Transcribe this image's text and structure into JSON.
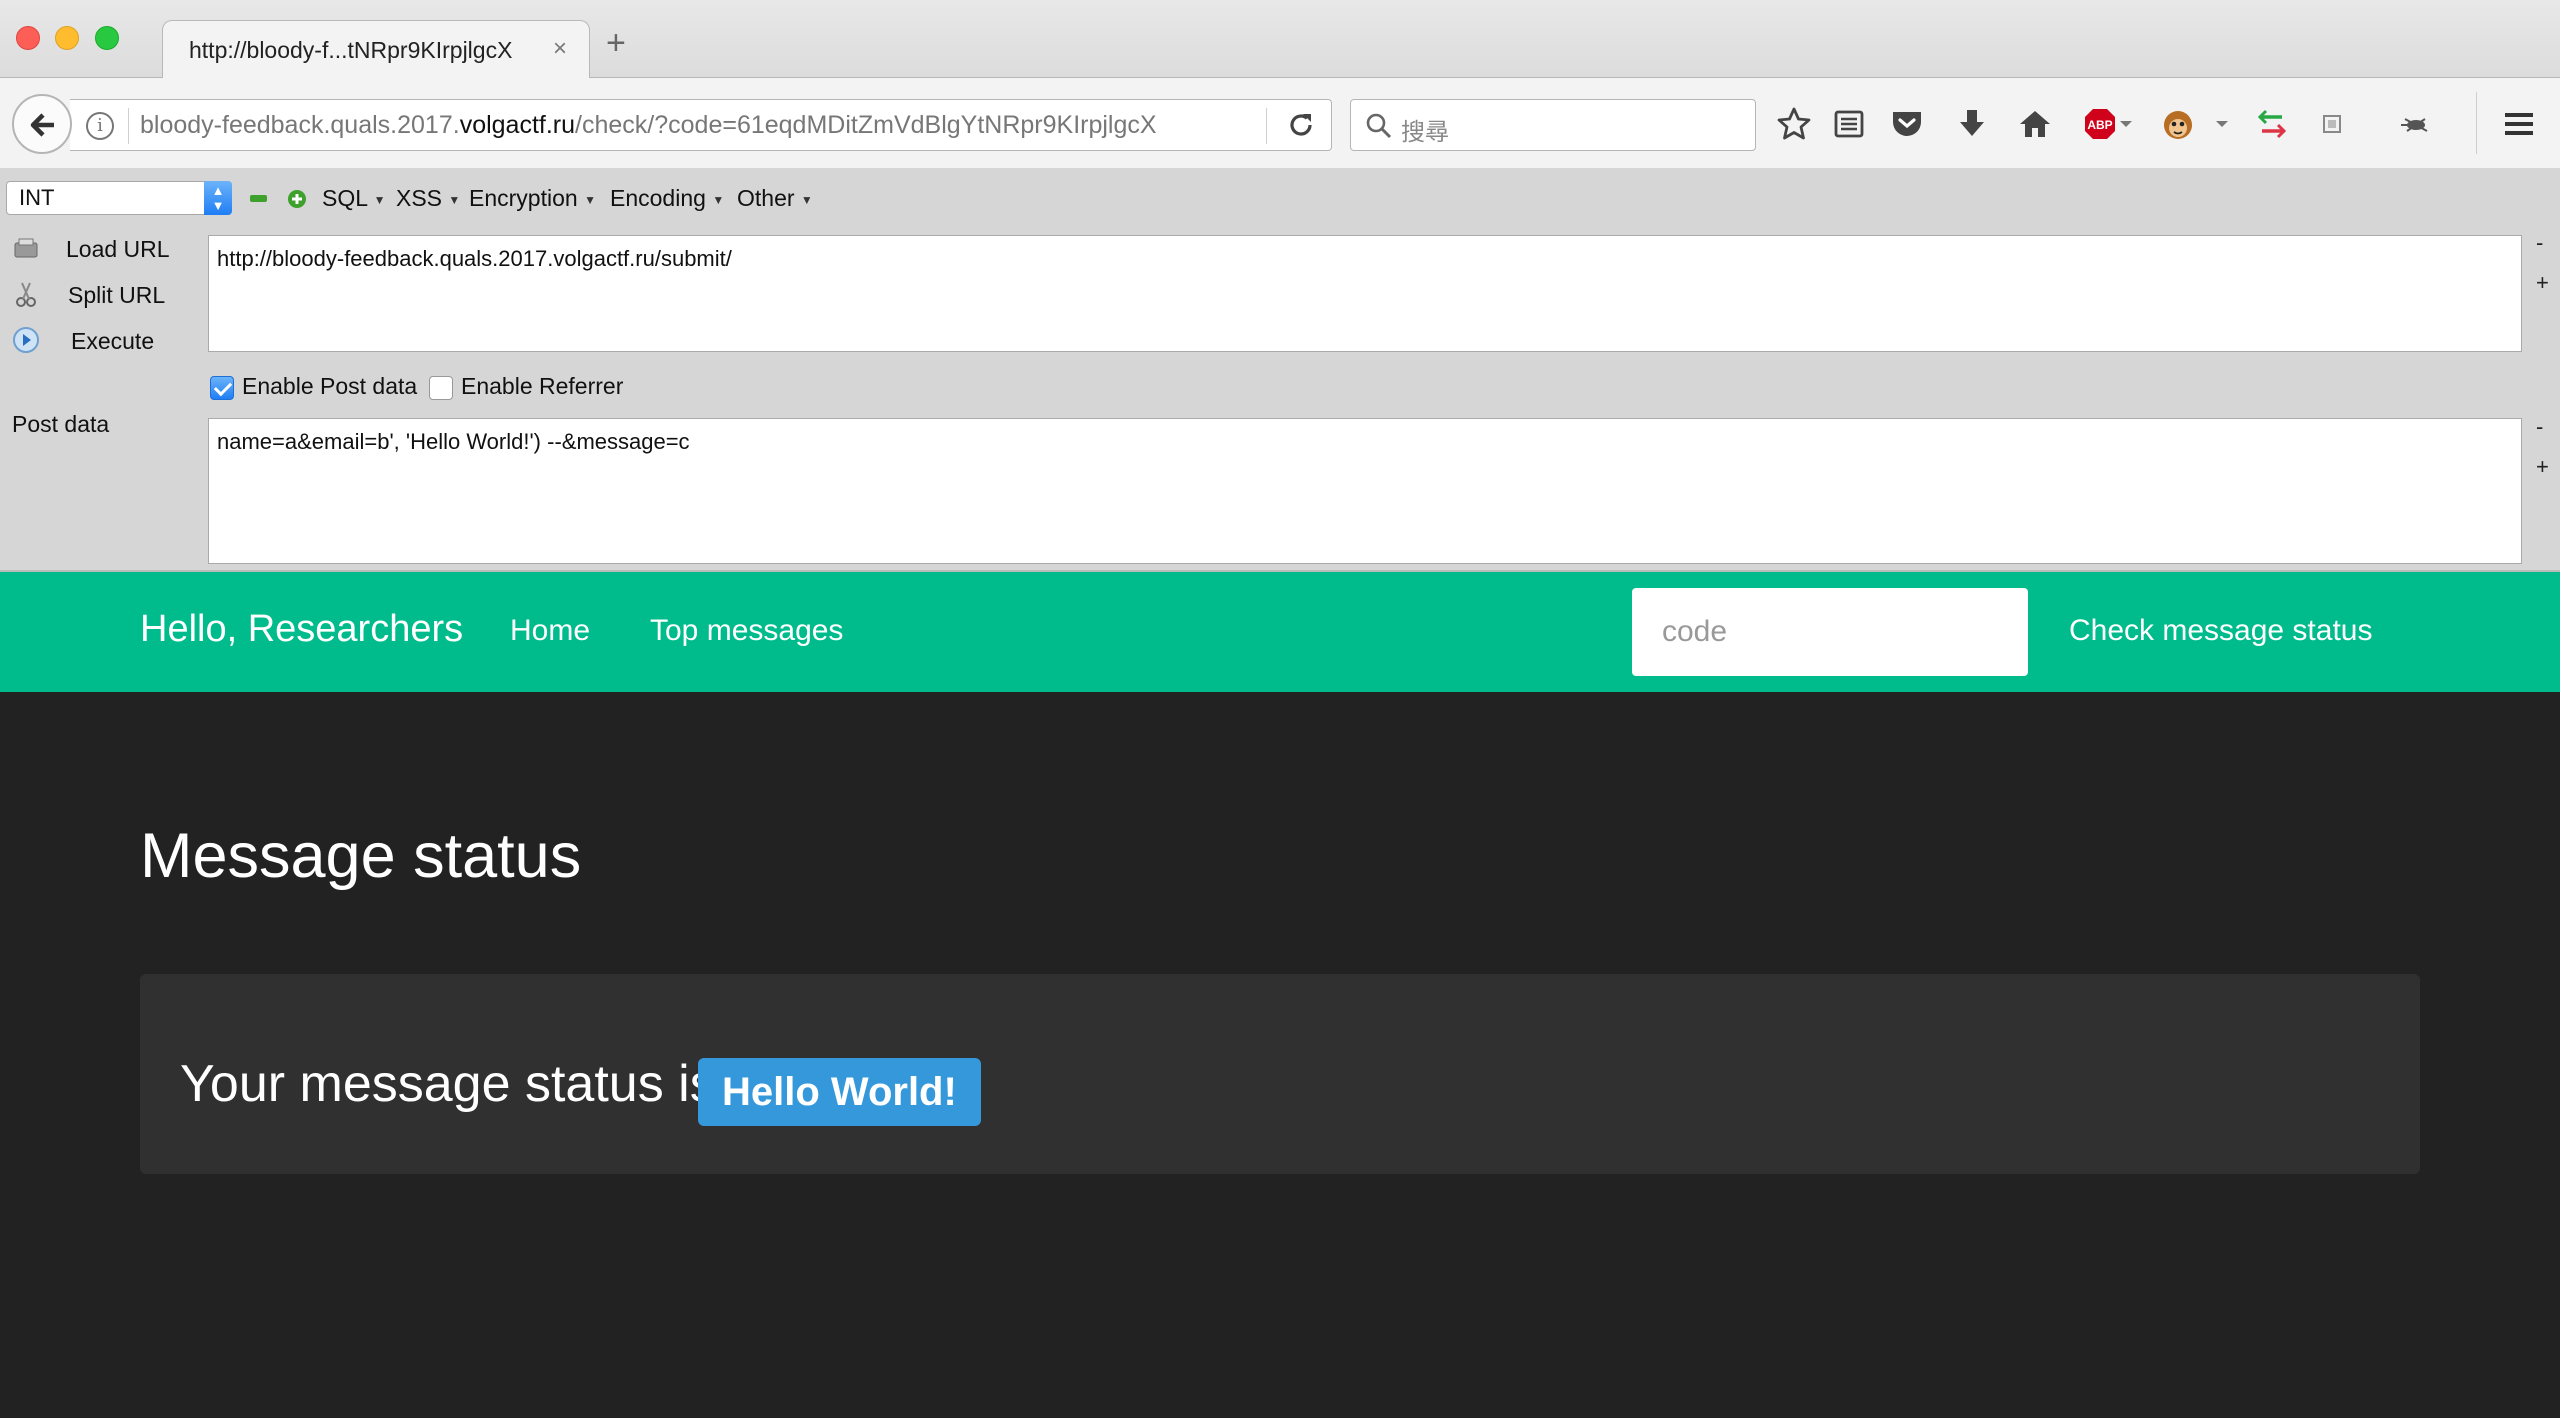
{
  "browser": {
    "tab_title": "http://bloody-f...tNRpr9KIrpjlgcX",
    "tab_close": "×",
    "new_tab": "+",
    "url_prefix": "bloody-feedback.quals.2017.",
    "url_domain": "volgactf.ru",
    "url_suffix": "/check/?code=61eqdMDitZmVdBlgYtNRpr9KIrpjlgcX",
    "search_placeholder": "搜尋",
    "info_glyph": "i"
  },
  "hackbar": {
    "type_select": "INT",
    "menus": [
      "SQL",
      "XSS",
      "Encryption",
      "Encoding",
      "Other"
    ],
    "side_actions": {
      "load": "Load URL",
      "split": "Split URL",
      "execute": "Execute"
    },
    "url_value": "http://bloody-feedback.quals.2017.volgactf.ru/submit/",
    "enable_post_label": "Enable Post data",
    "enable_post_checked": true,
    "enable_referrer_label": "Enable Referrer",
    "enable_referrer_checked": false,
    "post_label": "Post data",
    "post_value": "name=a&email=b', 'Hello World!') --&message=c",
    "minus": "-",
    "plus": "+"
  },
  "site": {
    "brand": "Hello, Researchers",
    "nav": {
      "home": "Home",
      "top_messages": "Top messages"
    },
    "code_placeholder": "code",
    "check_button": "Check message status",
    "page_title": "Message status",
    "status_text": "Your message status is",
    "status_value": "Hello World!",
    "colors": {
      "nav": "#00bc8c",
      "badge": "#3498db",
      "background": "#222222",
      "panel": "#303030"
    }
  }
}
